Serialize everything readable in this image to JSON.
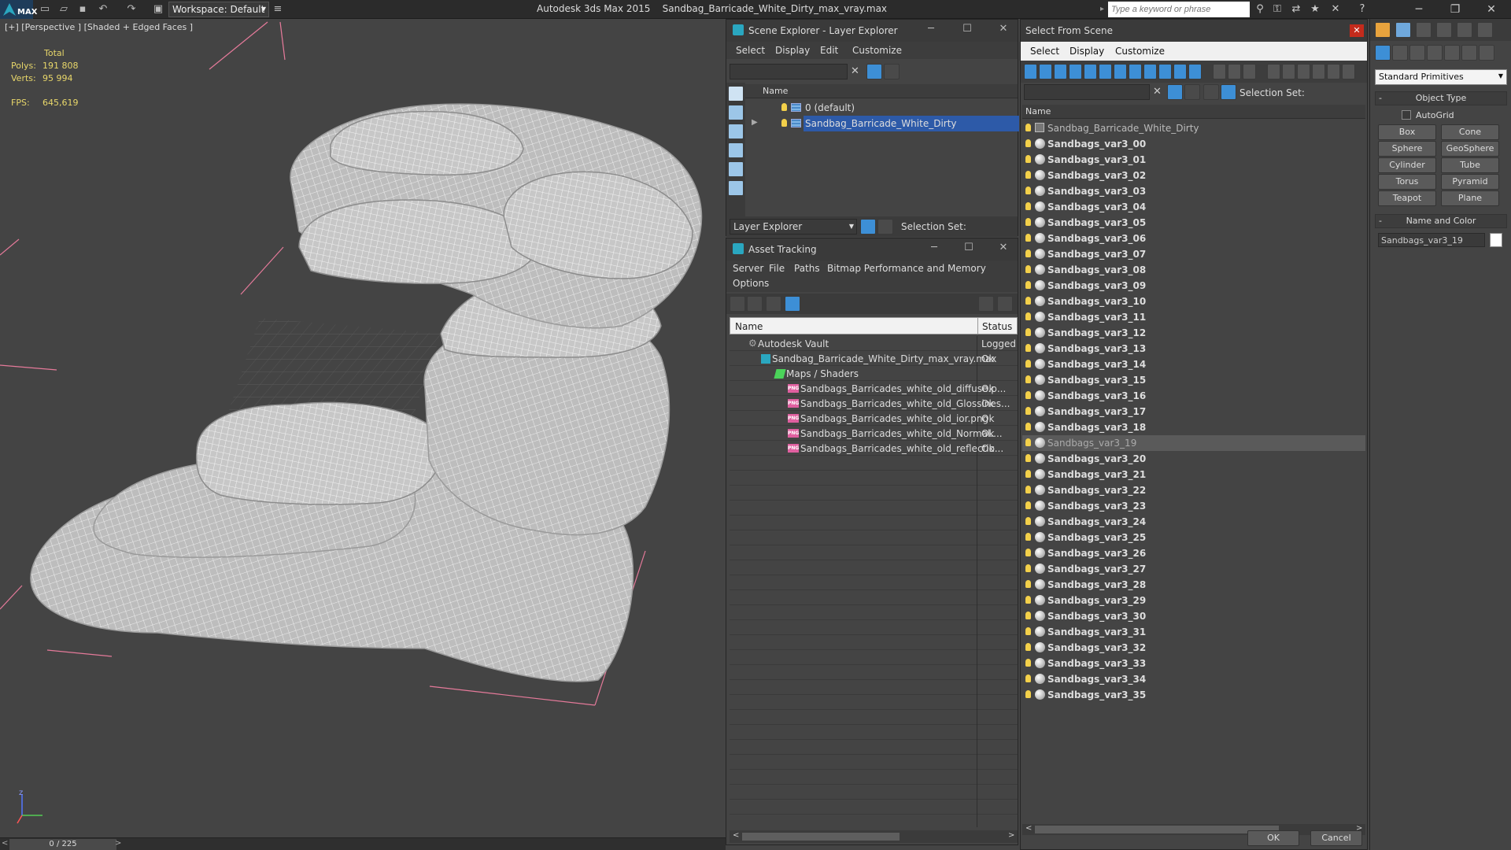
{
  "titlebar": {
    "logo": "MAX",
    "workspace": "Workspace: Default",
    "app_title": "Autodesk 3ds Max 2015",
    "file_title": "Sandbag_Barricade_White_Dirty_max_vray.max",
    "search_placeholder": "Type a keyword or phrase"
  },
  "viewport": {
    "label": "[+] [Perspective ] [Shaded + Edged Faces ]",
    "stats": {
      "caption": "Total",
      "polys_label": "Polys:",
      "polys": "191 808",
      "verts_label": "Verts:",
      "verts": "95 994",
      "fps_label": "FPS:",
      "fps": "645,619"
    },
    "axis": {
      "z": "z"
    },
    "timeline": "0 / 225"
  },
  "layer_explorer": {
    "title": "Scene Explorer - Layer Explorer",
    "menu": [
      "Select",
      "Display",
      "Edit",
      "Customize"
    ],
    "column_name": "Name",
    "rows": [
      {
        "label": "0 (default)",
        "selected": false
      },
      {
        "label": "Sandbag_Barricade_White_Dirty",
        "selected": true
      }
    ],
    "footer_dropdown": "Layer Explorer",
    "footer_selection_set": "Selection Set:"
  },
  "asset_tracking": {
    "title": "Asset Tracking",
    "menu": [
      "Server",
      "File",
      "Paths",
      "Bitmap Performance and Memory",
      "Options"
    ],
    "columns": {
      "name": "Name",
      "status": "Status"
    },
    "rows": [
      {
        "name": "Autodesk Vault",
        "status": "Logged",
        "indent": 0
      },
      {
        "name": "Sandbag_Barricade_White_Dirty_max_vray.max",
        "status": "Ok",
        "indent": 1
      },
      {
        "name": "Maps / Shaders",
        "status": "",
        "indent": 2
      },
      {
        "name": "Sandbags_Barricades_white_old_diffuse.p...",
        "status": "Ok",
        "indent": 3
      },
      {
        "name": "Sandbags_Barricades_white_old_Glossines...",
        "status": "Ok",
        "indent": 3
      },
      {
        "name": "Sandbags_Barricades_white_old_ior.png",
        "status": "Ok",
        "indent": 3
      },
      {
        "name": "Sandbags_Barricades_white_old_Normal....",
        "status": "Ok",
        "indent": 3
      },
      {
        "name": "Sandbags_Barricades_white_old_reflectio...",
        "status": "Ok",
        "indent": 3
      }
    ],
    "png_badge": "PNG"
  },
  "select_from_scene": {
    "title": "Select From Scene",
    "menu": [
      "Select",
      "Display",
      "Customize"
    ],
    "selection_set": "Selection Set:",
    "column_name": "Name",
    "root": "Sandbag_Barricade_White_Dirty",
    "items": [
      "Sandbags_var3_00",
      "Sandbags_var3_01",
      "Sandbags_var3_02",
      "Sandbags_var3_03",
      "Sandbags_var3_04",
      "Sandbags_var3_05",
      "Sandbags_var3_06",
      "Sandbags_var3_07",
      "Sandbags_var3_08",
      "Sandbags_var3_09",
      "Sandbags_var3_10",
      "Sandbags_var3_11",
      "Sandbags_var3_12",
      "Sandbags_var3_13",
      "Sandbags_var3_14",
      "Sandbags_var3_15",
      "Sandbags_var3_16",
      "Sandbags_var3_17",
      "Sandbags_var3_18",
      "Sandbags_var3_19",
      "Sandbags_var3_20",
      "Sandbags_var3_21",
      "Sandbags_var3_22",
      "Sandbags_var3_23",
      "Sandbags_var3_24",
      "Sandbags_var3_25",
      "Sandbags_var3_26",
      "Sandbags_var3_27",
      "Sandbags_var3_28",
      "Sandbags_var3_29",
      "Sandbags_var3_30",
      "Sandbags_var3_31",
      "Sandbags_var3_32",
      "Sandbags_var3_33",
      "Sandbags_var3_34",
      "Sandbags_var3_35"
    ],
    "highlighted": "Sandbags_var3_19",
    "ok": "OK",
    "cancel": "Cancel"
  },
  "command_panel": {
    "dropdown": "Standard Primitives",
    "object_type_title": "Object Type",
    "autogrid": "AutoGrid",
    "buttons": [
      "Box",
      "Cone",
      "Sphere",
      "GeoSphere",
      "Cylinder",
      "Tube",
      "Torus",
      "Pyramid",
      "Teapot",
      "Plane"
    ],
    "name_color_title": "Name and Color",
    "object_name": "Sandbags_var3_19",
    "object_color": "#ffffff"
  }
}
